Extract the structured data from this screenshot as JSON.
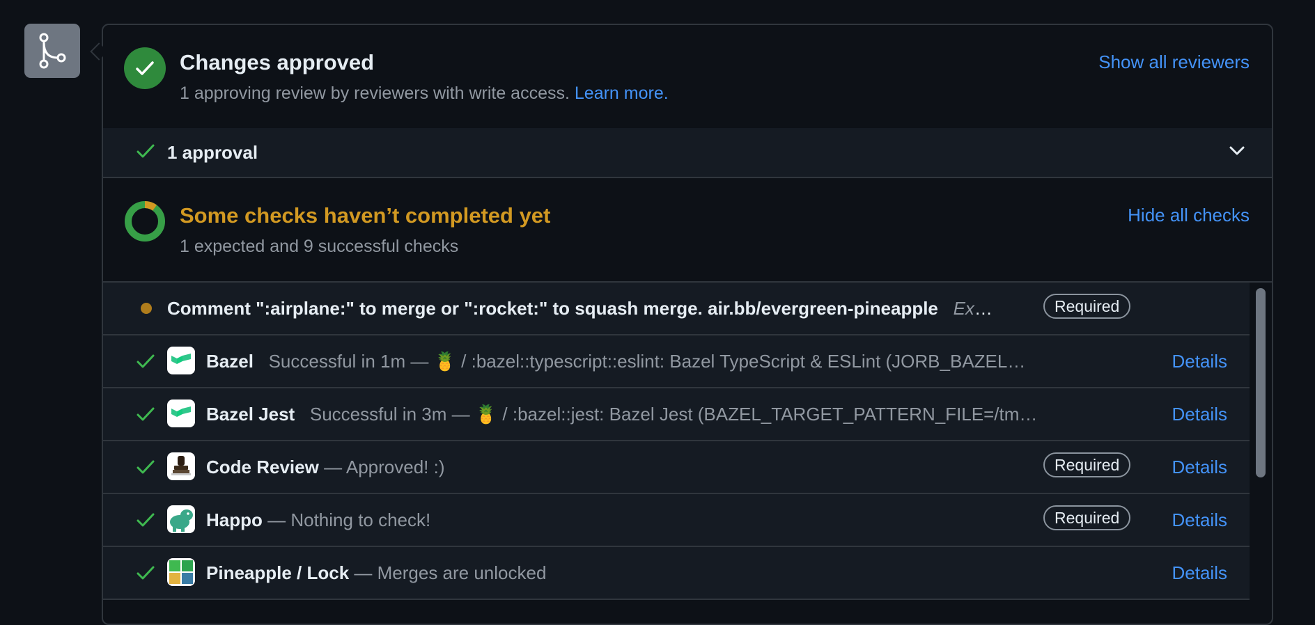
{
  "approved": {
    "title": "Changes approved",
    "subtitle": "1 approving review by reviewers with write access.",
    "learn_more": "Learn more.",
    "show_all": "Show all reviewers"
  },
  "approvals": {
    "label": "1 approval"
  },
  "checks": {
    "title": "Some checks haven’t completed yet",
    "subtitle": "1 expected and 9 successful checks",
    "hide_all": "Hide all checks",
    "items": [
      {
        "name": "Comment \":airplane:\" to merge or \":rocket:\" to squash merge. air.bb/evergreen-pineapple",
        "desc": "Expec…",
        "required": "Required",
        "status": "pending"
      },
      {
        "name": "Bazel",
        "desc": "Successful in 1m — 🍍 / :bazel::typescript::eslint: Bazel TypeScript & ESLint (JORB_BAZEL…",
        "details": "Details",
        "status": "success",
        "icon": "buildkite-icon"
      },
      {
        "name": "Bazel Jest",
        "desc": "Successful in 3m — 🍍 / :bazel::jest: Bazel Jest (BAZEL_TARGET_PATTERN_FILE=/tm…",
        "details": "Details",
        "status": "success",
        "icon": "buildkite-icon"
      },
      {
        "name": "Code Review",
        "desc": "— Approved! :)",
        "required": "Required",
        "details": "Details",
        "status": "success",
        "icon": "stamp-icon"
      },
      {
        "name": "Happo",
        "desc": "— Nothing to check!",
        "required": "Required",
        "details": "Details",
        "status": "success",
        "icon": "hippo-icon"
      },
      {
        "name": "Pineapple / Lock",
        "desc": "— Merges are unlocked",
        "details": "Details",
        "status": "success",
        "icon": "pineapple-lock-icon"
      }
    ]
  },
  "colors": {
    "success": "#3fb950",
    "pending": "#d29922",
    "link": "#4493f8"
  }
}
